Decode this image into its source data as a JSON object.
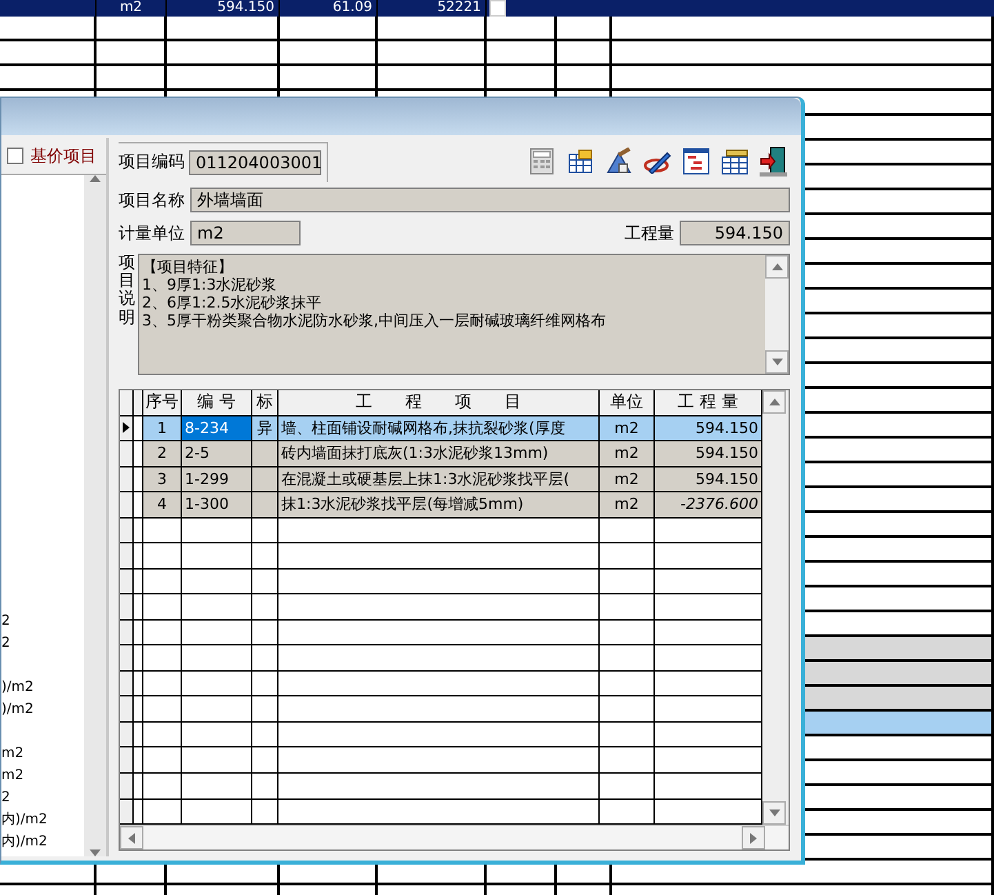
{
  "sheet": {
    "top_row": {
      "cells": [
        "m2",
        "594.150",
        "61.09",
        "52221"
      ],
      "checked": false
    },
    "rows": [
      {
        "selected": false,
        "shaded": false
      },
      {
        "selected": false,
        "shaded": false
      },
      {
        "selected": false,
        "shaded": false
      },
      {
        "selected": false,
        "shaded": false
      },
      {
        "selected": false,
        "shaded": false
      },
      {
        "selected": false,
        "shaded": false
      },
      {
        "selected": false,
        "shaded": false
      },
      {
        "selected": false,
        "shaded": false
      },
      {
        "selected": false,
        "shaded": false
      },
      {
        "selected": false,
        "shaded": false
      },
      {
        "selected": false,
        "shaded": false
      },
      {
        "selected": false,
        "shaded": false
      },
      {
        "selected": false,
        "shaded": false
      },
      {
        "selected": false,
        "shaded": false
      },
      {
        "selected": false,
        "shaded": false
      },
      {
        "selected": false,
        "shaded": false
      },
      {
        "selected": false,
        "shaded": false
      },
      {
        "selected": false,
        "shaded": false
      },
      {
        "selected": false,
        "shaded": false
      },
      {
        "selected": false,
        "shaded": false
      },
      {
        "selected": false,
        "shaded": false
      },
      {
        "selected": false,
        "shaded": false
      },
      {
        "selected": false,
        "shaded": false
      },
      {
        "selected": false,
        "shaded": false
      },
      {
        "selected": false,
        "shaded": false
      },
      {
        "selected": false,
        "shaded": true
      },
      {
        "selected": false,
        "shaded": true
      },
      {
        "selected": false,
        "shaded": true
      },
      {
        "selected": true,
        "shaded": false
      },
      {
        "selected": false,
        "shaded": false
      },
      {
        "selected": false,
        "shaded": false
      },
      {
        "selected": false,
        "shaded": false
      },
      {
        "selected": false,
        "shaded": false
      },
      {
        "selected": false,
        "shaded": false
      },
      {
        "selected": false,
        "shaded": false
      },
      {
        "selected": false,
        "shaded": false
      }
    ]
  },
  "left_panel": {
    "checkbox": {
      "label": "基价项目",
      "checked": false
    },
    "items": [
      {
        "text": "2",
        "kind": "line"
      },
      {
        "text": "2",
        "kind": "line"
      },
      {
        "text": ")/m2",
        "kind": "spaced"
      },
      {
        "text": ")/m2",
        "kind": "line"
      },
      {
        "text": "m2",
        "kind": "spaced"
      },
      {
        "text": "m2",
        "kind": "line"
      },
      {
        "text": "2",
        "kind": "line"
      },
      {
        "text": "内)/m2",
        "kind": "line"
      },
      {
        "text": "内)/m2",
        "kind": "line"
      }
    ]
  },
  "form": {
    "code_label": "项目编码",
    "code": "011204003001",
    "name_label": "项目名称",
    "name": "外墙墙面",
    "unit_label": "计量单位",
    "unit": "m2",
    "quantity_label": "工程量",
    "quantity": "594.150",
    "description_label": "项目说明",
    "description": [
      "【项目特征】",
      "1、9厚1:3水泥砂浆",
      "2、6厚1:2.5水泥砂浆抹平",
      "3、5厚干粉类聚合物水泥防水砂浆,中间压入一层耐碱玻璃纤维网格布"
    ]
  },
  "grid": {
    "columns": [
      "序号",
      "编 号",
      "标",
      "工　　程　　项　　目",
      "单位",
      "工 程 量"
    ],
    "rows": [
      {
        "no": "1",
        "code": "8-234",
        "mark": "异",
        "item": "墙、柱面铺设耐碱网格布,抹抗裂砂浆(厚度",
        "unit": "m2",
        "quantity": "594.150",
        "selected": true,
        "italic": false
      },
      {
        "no": "2",
        "code": "2-5",
        "item": "砖内墙面抹打底灰(1:3水泥砂浆13mm)",
        "unit": "m2",
        "quantity": "594.150",
        "selected": false,
        "italic": false
      },
      {
        "no": "3",
        "code": "1-299",
        "item": "在混凝土或硬基层上抹1:3水泥砂浆找平层(",
        "unit": "m2",
        "quantity": "594.150",
        "selected": false,
        "italic": false
      },
      {
        "no": "4",
        "code": "1-300",
        "item": "抹1:3水泥砂浆找平层(每增减5mm)",
        "unit": "m2",
        "quantity": "-2376.600",
        "selected": false,
        "italic": true
      }
    ]
  }
}
